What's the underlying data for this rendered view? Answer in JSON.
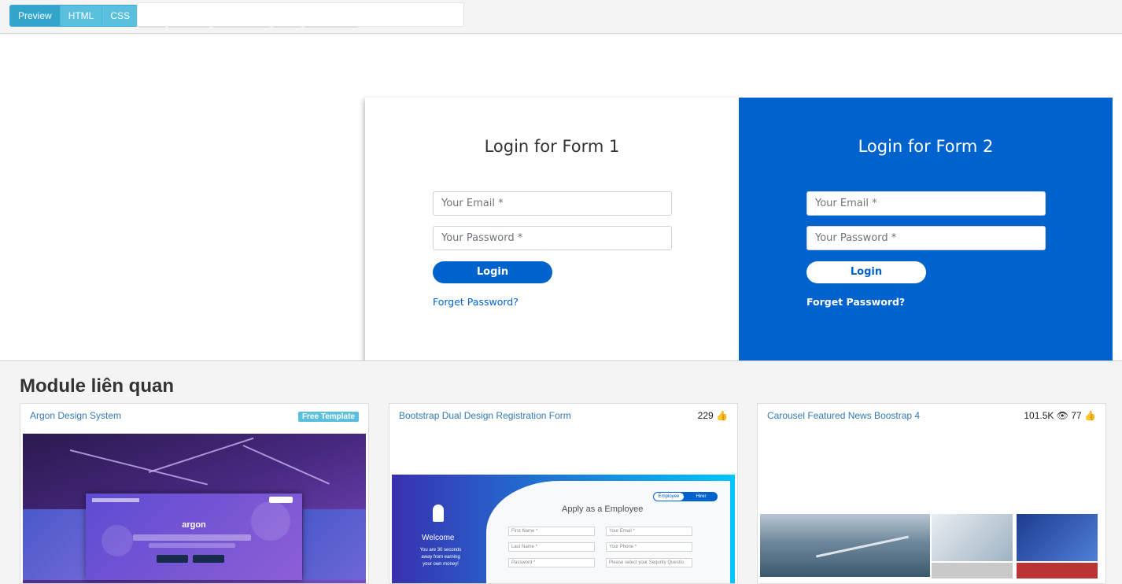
{
  "toolbar": {
    "tabs": [
      {
        "label": "Preview",
        "active": true
      },
      {
        "label": "HTML",
        "active": false
      },
      {
        "label": "CSS",
        "active": false
      }
    ]
  },
  "preview": {
    "form1": {
      "title": "Login for Form 1",
      "email_placeholder": "Your Email *",
      "password_placeholder": "Your Password *",
      "button": "Login",
      "forget": "Forget Password?"
    },
    "form2": {
      "title": "Login for Form 2",
      "email_placeholder": "Your Email *",
      "password_placeholder": "Your Password *",
      "button": "Login",
      "forget": "Forget Password?"
    },
    "colors": {
      "primary": "#0062cc",
      "white": "#ffffff"
    }
  },
  "related": {
    "heading": "Module liên quan",
    "cards": [
      {
        "title": "Argon Design System",
        "badge": "Free Template",
        "thumb": {
          "logo": "argon"
        }
      },
      {
        "title": "Bootstrap Dual Design Registration Form",
        "likes": "229",
        "thumb": {
          "title": "Apply as a Employee",
          "toggle": "Employee",
          "toggle_other": "Hirer",
          "welcome": "Welcome",
          "text": "You are 30 seconds away from earning your own money!",
          "fields": [
            "First Name *",
            "Your Email *",
            "Last Name *",
            "Your Phone *",
            "Password *",
            "Please select your Sequrity Questio"
          ]
        }
      },
      {
        "title": "Carousel Featured News Boostrap 4",
        "views": "101.5K",
        "likes": "77"
      }
    ]
  }
}
